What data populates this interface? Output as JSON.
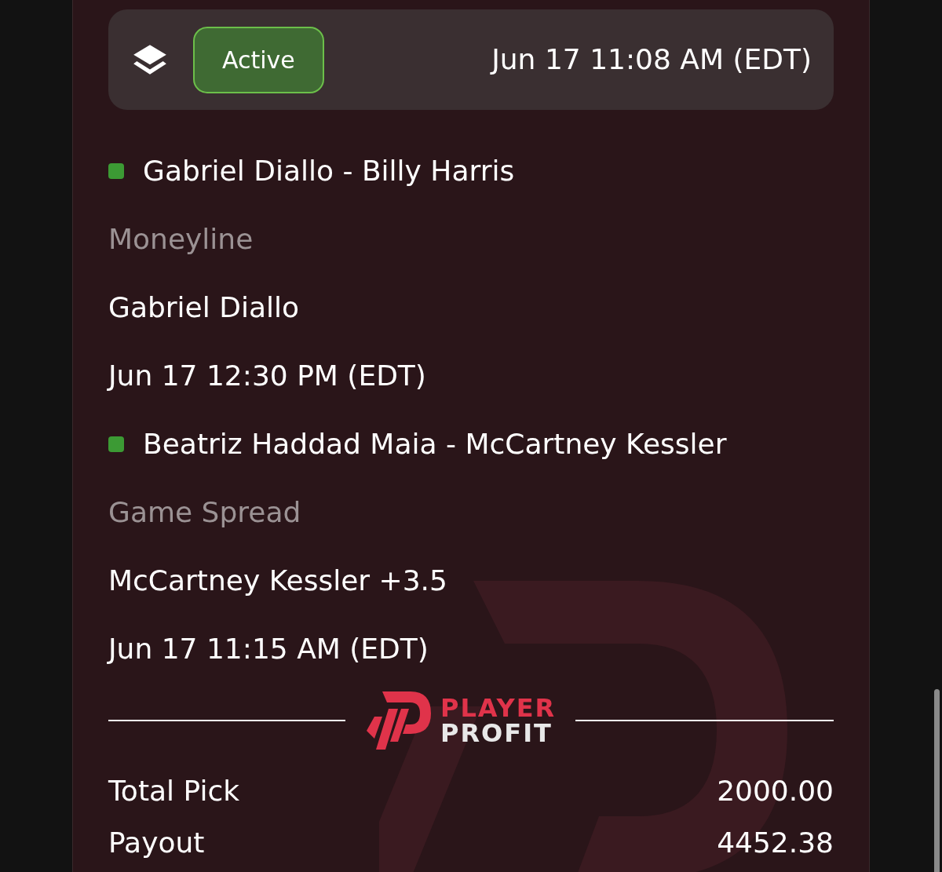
{
  "header": {
    "status": "Active",
    "placed_time": "Jun 17 11:08 AM (EDT)"
  },
  "legs": [
    {
      "match": "Gabriel Diallo - Billy Harris",
      "color": "#3c9a34",
      "market": "Moneyline",
      "selection": "Gabriel Diallo",
      "start_time": "Jun 17 12:30 PM (EDT)"
    },
    {
      "match": "Beatriz Haddad Maia - McCartney Kessler",
      "color": "#3c9a34",
      "market": "Game Spread",
      "selection": "McCartney Kessler +3.5",
      "start_time": "Jun 17 11:15 AM (EDT)"
    }
  ],
  "logo": {
    "line_1": "PLAYER",
    "line_2": "PROFIT"
  },
  "totals": [
    {
      "label": "Total Pick",
      "value": "2000.00"
    },
    {
      "label": "Payout",
      "value": "4452.38"
    }
  ]
}
